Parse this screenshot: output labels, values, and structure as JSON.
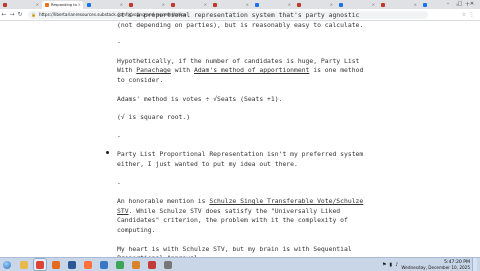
{
  "browser": {
    "tabs": [
      {
        "label": "",
        "active": false,
        "color": "#c0392b"
      },
      {
        "label": "Responding to Kyrt...",
        "active": true,
        "color": "#e8711a"
      },
      {
        "label": "",
        "active": false,
        "color": "#1a73e8"
      },
      {
        "label": "",
        "active": false,
        "color": "#c0392b"
      },
      {
        "label": "",
        "active": false,
        "color": "#c0392b"
      },
      {
        "label": "",
        "active": false,
        "color": "#c0392b"
      },
      {
        "label": "",
        "active": false,
        "color": "#1a73e8"
      },
      {
        "label": "",
        "active": false,
        "color": "#c0392b"
      },
      {
        "label": "",
        "active": false,
        "color": "#1a73e8"
      },
      {
        "label": "",
        "active": false,
        "color": "#c0392b"
      },
      {
        "label": "",
        "active": false,
        "color": "#1a73e8"
      }
    ],
    "url": "https://libertarianresources.substack.com/p/voting-and-representation"
  },
  "article": {
    "p1": "it's a proportional representation system that's party agnostic (not depending on parties), but is reasonably easy to calculate.",
    "sep1": "-",
    "p2a": "Hypothetically, if the number of candidates is huge, Party List With ",
    "p2_link1": "Panachage",
    "p2b": " with ",
    "p2_link2": "Adam's method of apportionment",
    "p2c": " is one method to consider.",
    "p3": "Adams' method is votes ÷ √Seats (Seats +1).",
    "p4": "(√ is square root.)",
    "sep2": "-",
    "p5": "Party List Proportional Representation isn't my preferred system either, I just wanted to put my idea out there.",
    "sep3": "-",
    "p6a": "An honorable mention is ",
    "p6_link": "Schulze Single Transferable Vote/Schulze STV",
    "p6b": ". While Schulze STV does satisfy the \"Universally Liked Candidates\" criterion, the problem with it the complexity of computing.",
    "p7": "My heart is with Schulze STV, but my brain is with Sequential Proportional Approval."
  },
  "taskbar": {
    "items": [
      {
        "name": "explorer",
        "color": "#e8b84a"
      },
      {
        "name": "chrome",
        "color": "#db4437"
      },
      {
        "name": "media",
        "color": "#e36c1e"
      },
      {
        "name": "word",
        "color": "#2b5797"
      },
      {
        "name": "firefox",
        "color": "#ff7139"
      },
      {
        "name": "app-blue",
        "color": "#3b78c4"
      },
      {
        "name": "app-green",
        "color": "#3aa655"
      },
      {
        "name": "app-orange",
        "color": "#d9822b"
      },
      {
        "name": "app-red",
        "color": "#c23b3b"
      },
      {
        "name": "app-gray",
        "color": "#777777"
      }
    ],
    "time": "5:47:20 PM",
    "date": "Wednesday, December 10, 2025"
  }
}
